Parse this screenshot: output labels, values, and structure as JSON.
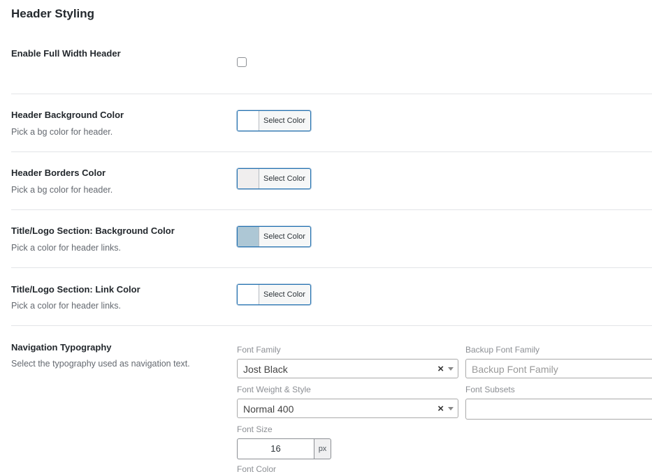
{
  "section": {
    "title": "Header Styling"
  },
  "rows": {
    "full_width": {
      "label": "Enable Full Width Header",
      "checked": false
    },
    "bg_color": {
      "label": "Header Background Color",
      "desc": "Pick a bg color for header.",
      "button": "Select Color",
      "swatch": "#ffffff"
    },
    "border_color": {
      "label": "Header Borders Color",
      "desc": "Pick a bg color for header.",
      "button": "Select Color",
      "swatch": "#f0eeee"
    },
    "logo_bg": {
      "label": "Title/Logo Section: Background Color",
      "desc": "Pick a color for header links.",
      "button": "Select Color",
      "swatch": "#adc7d5"
    },
    "logo_link": {
      "label": "Title/Logo Section: Link Color",
      "desc": "Pick a color for header links.",
      "button": "Select Color",
      "swatch": "#ffffff"
    },
    "nav_typo": {
      "label": "Navigation Typography",
      "desc": "Select the typography used as navigation text."
    }
  },
  "typography": {
    "font_family": {
      "label": "Font Family",
      "value": "Jost Black",
      "clear": "×"
    },
    "backup_font": {
      "label": "Backup Font Family",
      "placeholder": "Backup Font Family"
    },
    "font_weight": {
      "label": "Font Weight & Style",
      "value": "Normal 400",
      "clear": "×"
    },
    "font_subsets": {
      "label": "Font Subsets",
      "value": ""
    },
    "font_size": {
      "label": "Font Size",
      "value": "16",
      "unit": "px"
    },
    "font_color": {
      "label": "Font Color"
    }
  },
  "accent_color": "#2271b1"
}
